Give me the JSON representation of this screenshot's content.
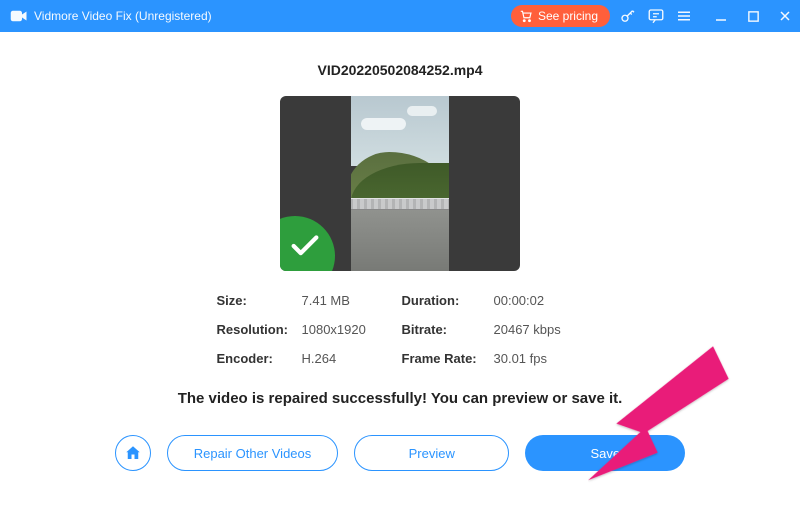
{
  "titlebar": {
    "app_title": "Vidmore Video Fix (Unregistered)",
    "see_pricing_label": "See pricing"
  },
  "file": {
    "name": "VID20220502084252.mp4"
  },
  "info": {
    "size_label": "Size:",
    "size_value": "7.41 MB",
    "duration_label": "Duration:",
    "duration_value": "00:00:02",
    "resolution_label": "Resolution:",
    "resolution_value": "1080x1920",
    "bitrate_label": "Bitrate:",
    "bitrate_value": "20467 kbps",
    "encoder_label": "Encoder:",
    "encoder_value": "H.264",
    "framerate_label": "Frame Rate:",
    "framerate_value": "30.01 fps"
  },
  "messages": {
    "success": "The video is repaired successfully! You can preview or save it."
  },
  "actions": {
    "repair_other": "Repair Other Videos",
    "preview": "Preview",
    "save": "Save"
  }
}
